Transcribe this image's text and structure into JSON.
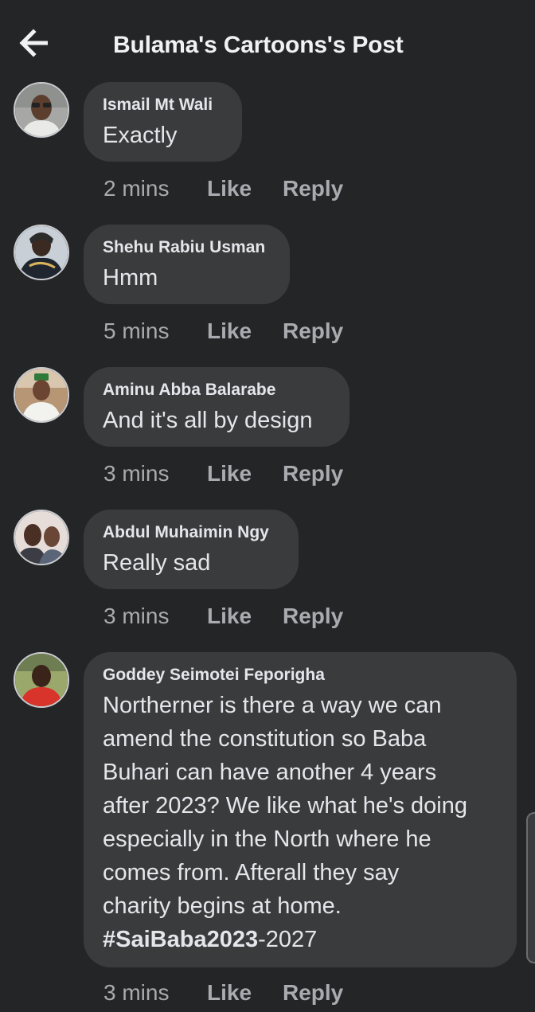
{
  "header": {
    "title": "Bulama's Cartoons's Post"
  },
  "comments": [
    {
      "author": "Ismail Mt Wali",
      "text": "Exactly",
      "time": "2 mins",
      "like": "Like",
      "reply": "Reply"
    },
    {
      "author": "Shehu Rabiu Usman",
      "text": "Hmm",
      "time": "5 mins",
      "like": "Like",
      "reply": "Reply"
    },
    {
      "author": "Aminu Abba Balarabe",
      "text": "And it's all by design",
      "time": "3 mins",
      "like": "Like",
      "reply": "Reply"
    },
    {
      "author": "Abdul Muhaimin Ngy",
      "text": "Really sad",
      "time": "3 mins",
      "like": "Like",
      "reply": "Reply"
    },
    {
      "author": "Goddey Seimotei Feporigha",
      "text_lines": [
        "Northerner is there a way we can",
        "amend the constitution so Baba",
        "Buhari can have another 4 years",
        "after 2023? We like what he's doing",
        "especially in the North where he",
        "comes from. Afterall they say",
        "charity begins at home."
      ],
      "hashtag": "#SaiBaba2023",
      "hashtag_suffix": "-2027",
      "time": "3 mins",
      "like": "Like",
      "reply": "Reply"
    }
  ],
  "colors": {
    "background": "#242526",
    "bubble": "#3a3b3c",
    "text": "#e4e6eb",
    "meta": "#a8abaf"
  },
  "icons": {
    "back": "arrow-left-icon"
  }
}
